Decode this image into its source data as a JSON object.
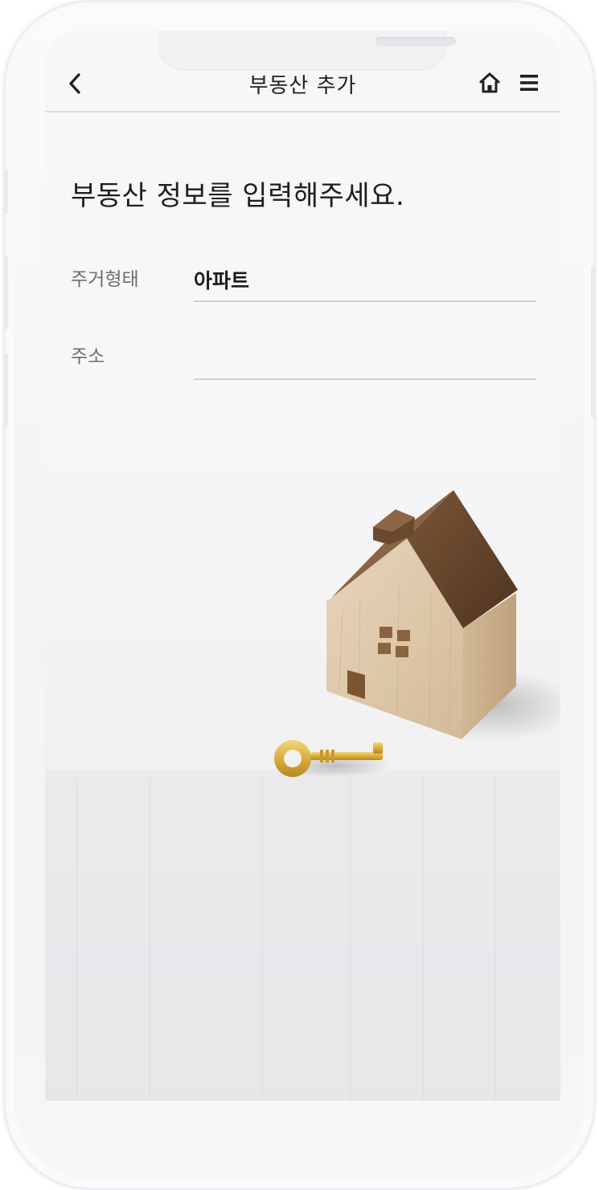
{
  "navbar": {
    "title": "부동산 추가",
    "back_icon": "chevron-left-icon",
    "home_icon": "home-icon",
    "menu_icon": "hamburger-menu-icon"
  },
  "form": {
    "heading": "부동산 정보를 입력해주세요.",
    "fields": [
      {
        "label": "주거형태",
        "value": "아파트"
      },
      {
        "label": "주소",
        "value": ""
      }
    ]
  },
  "colors": {
    "text_primary": "#1f1f1f",
    "label_gray": "#6d6d70",
    "divider": "#cfcfd2",
    "wood_light": "#d9c1a0",
    "wood_roof": "#6b4a30",
    "key_gold": "#d8ad3c"
  }
}
